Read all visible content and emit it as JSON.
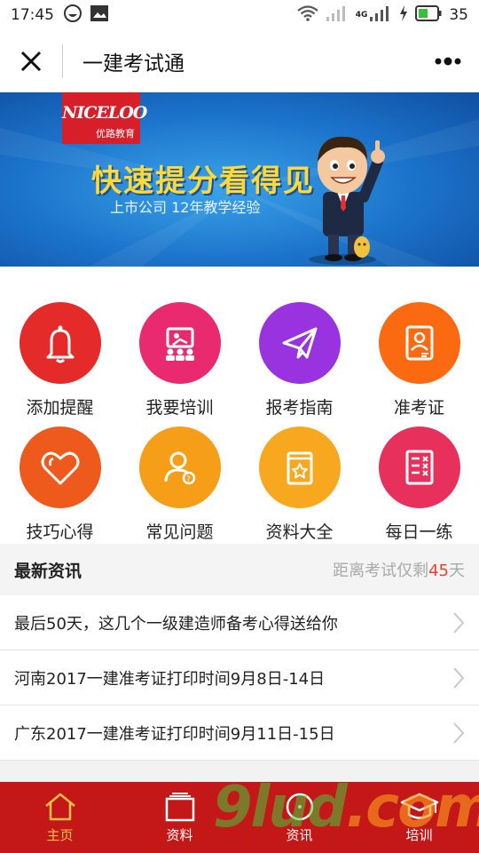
{
  "status": {
    "time": "17:45",
    "battery": "35",
    "net": "4G"
  },
  "nav": {
    "title": "一建考试通"
  },
  "banner": {
    "brand": "NICELOO",
    "brand_cn": "优路教育",
    "slogan": "快速提分看得见",
    "subtitle": "上市公司  12年教学经验"
  },
  "tiles": [
    {
      "label": "添加提醒",
      "icon": "bell-icon",
      "color": "#e52a2a"
    },
    {
      "label": "我要培训",
      "icon": "training-icon",
      "color": "#ea2a6e"
    },
    {
      "label": "报考指南",
      "icon": "paper-plane-icon",
      "color": "#9933e0"
    },
    {
      "label": "准考证",
      "icon": "id-card-icon",
      "color": "#fb6a10"
    },
    {
      "label": "技巧心得",
      "icon": "heart-icon",
      "color": "#ee5a1c"
    },
    {
      "label": "常见问题",
      "icon": "person-question-icon",
      "color": "#f79e18"
    },
    {
      "label": "资料大全",
      "icon": "book-star-icon",
      "color": "#f7a81e"
    },
    {
      "label": "每日一练",
      "icon": "checklist-icon",
      "color": "#e8305c"
    }
  ],
  "news": {
    "heading": "最新资讯",
    "countdown_prefix": "距离考试仅剩",
    "countdown_days": "45",
    "countdown_suffix": "天",
    "items": [
      "最后50天，这几个一级建造师备考心得送给你",
      "河南2017一建准考证打印时间9月8日-14日",
      "广东2017一建准考证打印时间9月11日-15日"
    ]
  },
  "tabbar": [
    {
      "label": "主页",
      "icon": "home-icon",
      "active": true
    },
    {
      "label": "资料",
      "icon": "folder-icon",
      "active": false
    },
    {
      "label": "资讯",
      "icon": "news-icon",
      "active": false
    },
    {
      "label": "培训",
      "icon": "graduation-cap-icon",
      "active": false
    }
  ],
  "watermark": {
    "text": "9lud",
    "suffix": ".com"
  },
  "colors": {
    "accent": "#c41818",
    "tab_active": "#f6c14b",
    "countdown": "#e8412c"
  }
}
